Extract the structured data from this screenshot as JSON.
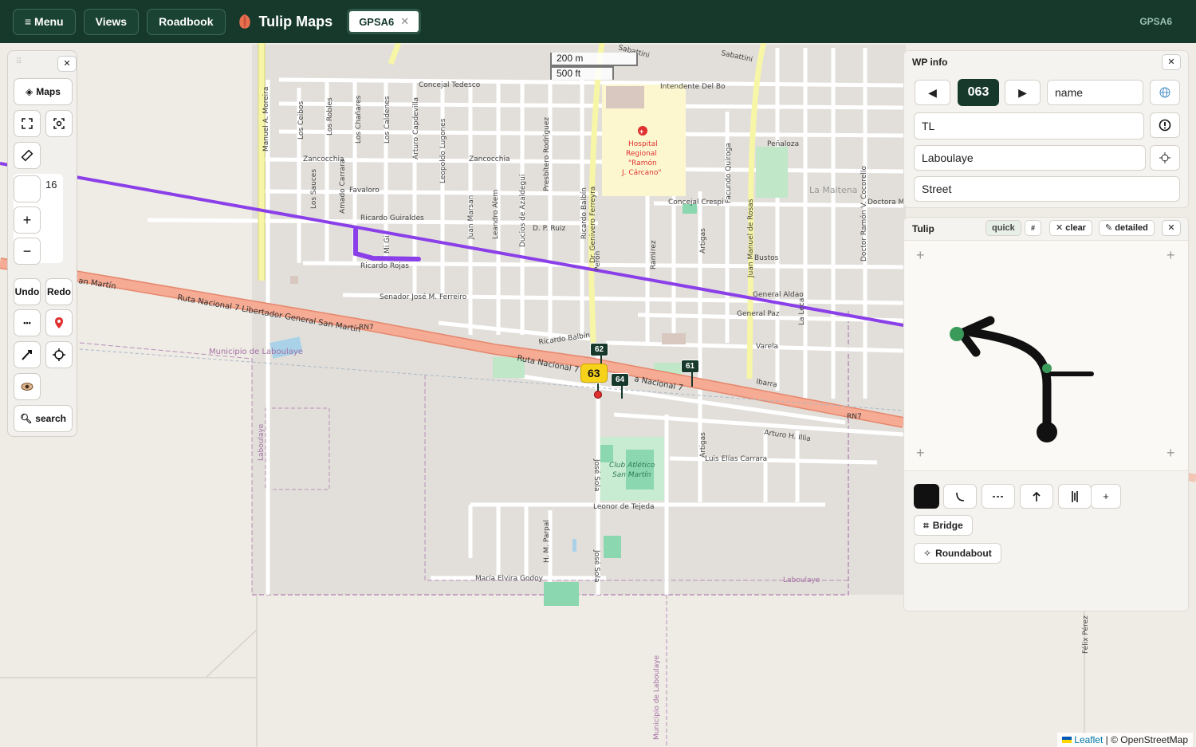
{
  "topbar": {
    "menu_label": "≡ Menu",
    "views_label": "Views",
    "roadbook_label": "Roadbook",
    "app_title": "Tulip Maps",
    "tab_label": "GPSA6",
    "tab_close": "✕",
    "right_label": "GPSA6"
  },
  "map": {
    "scale_metric": "200 m",
    "scale_imperial": "500 ft",
    "attribution_leaflet": "Leaflet",
    "attribution_osm": "| © OpenStreetMap",
    "street_labels": {
      "concejal_tedesco": "Concejal Tedesco",
      "intendente_del_bo": "Intendente Del Bo",
      "sabattini": "Sabattini",
      "sabattini2": "Sabattini",
      "manuel_moreira": "Manuel A. Moreira",
      "los_ceibos": "Los Ceibos",
      "los_robles": "Los Robles",
      "los_chanares": "Los Chañares",
      "los_caldenes": "Los Caldenes",
      "arturo_capdevilla": "Arturo Capdevilla",
      "leopoldo_lugones": "Leopoldo Lugones",
      "presbitero_rodriguez": "Presbítero Rodríguez",
      "zancocchia1": "Zancocchia",
      "zancocchia2": "Zancocchia",
      "los_sauces": "Los Sauces",
      "amado_carrara": "Amado Carrara",
      "favaloro": "Favaloro",
      "ricardo_guiraldes": "Ricardo Guiraldes",
      "ricardo_rojas": "Ricardo Rojas",
      "juan_marsan": "Juan Marsan",
      "leandro_alem": "Leandro Alem",
      "ducios": "Ducios de Azaldegui",
      "dp_ruiz": "D. P. Ruiz",
      "ricardo_balbin1": "Ricardo Balbín",
      "dr_ferreyra": "Dr. Genivero Ferreyra",
      "hospital": "Hospital",
      "hospital2": "Regional",
      "hospital3": "\"Ramón",
      "hospital4": "J. Cárcano\"",
      "facundo_quiroga": "Facundo Quiroga",
      "penaloza": "Peñaloza",
      "la_maitena": "La Maitena",
      "doctora_m": "Doctora M",
      "concejal_crespi": "Concejal Crespi",
      "juan_manuel_rosas": "Juan Manuel de Rosas",
      "doctor_ramon": "Doctor Ramón V. Cocorello",
      "ramirez": "Ramirez",
      "artigas1": "Artigas",
      "bustos": "Bustos",
      "general_aldao": "General Aldao",
      "general_paz": "General Paz",
      "varela": "Varela",
      "ibarra": "Ibarra",
      "senador_ferreiro": "Senador José M. Ferreiro",
      "ruta_nacional": "Ruta Nacional 7 Libertador General San Martín",
      "rn7_1": "RN7",
      "rn7_2": "RN7",
      "san_martin": "an Martín",
      "ruta_nac_7b": "Ruta Nacional 7",
      "a_nacional_7": "a Nacional 7",
      "municipio1": "Municipio de Laboulaye",
      "laboulaye_v": "Laboulaye",
      "ricardo_balbin2": "Ricardo Balbín",
      "jose_sola1": "José Sola",
      "jose_sola2": "José Sola",
      "club_atletico": "Club Atlético",
      "club_san_martin": "San Martín",
      "arturo_illia": "Arturo H. Illia",
      "artigas2": "Artigas",
      "luis_elias": "Luis Elías Carrara",
      "leonor_tejeda": "Leonor de Tejeda",
      "hm_parpal": "H. M. Parpal",
      "maria_elvira": "María Elvira Godoy",
      "laboulaye_h": "Laboulaye",
      "municipio2": "Municipio de Laboulaye",
      "felix_perez": "Félix Pérez",
      "mi_gi": "Mi Gi",
      "peron": "Perón",
      "la_leca": "La Leca"
    },
    "waypoints": {
      "wp62": "62",
      "wp63": "63",
      "wp64": "64",
      "wp61": "61"
    },
    "colors": {
      "route": "#8a3fe8",
      "highway": "#f2a28c",
      "arterial": "#f7f5a6",
      "park": "#bfe7c8",
      "brand": "#16392c"
    }
  },
  "toolbar": {
    "drag_handle": "⠿",
    "close": "✕",
    "maps_label": "Maps",
    "zoom_value": "16",
    "zoom_in": "+",
    "zoom_out": "−",
    "undo_label": "Undo",
    "redo_label": "Redo",
    "more": "•••",
    "search_label": "search"
  },
  "wp_info": {
    "title": "WP info",
    "close": "✕",
    "prev": "◀",
    "next": "▶",
    "number": "063",
    "name_placeholder": "name",
    "type_value": "TL",
    "city_value": "Laboulaye",
    "street_value": "Street"
  },
  "tulip": {
    "title": "Tulip",
    "quick": "quick",
    "hash": "#",
    "clear": "✕ clear",
    "detailed": "✎ detailed",
    "close": "✕",
    "plus": "+",
    "tool_plus": "+",
    "bridge_label": "Bridge",
    "roundabout_label": "Roundabout"
  }
}
